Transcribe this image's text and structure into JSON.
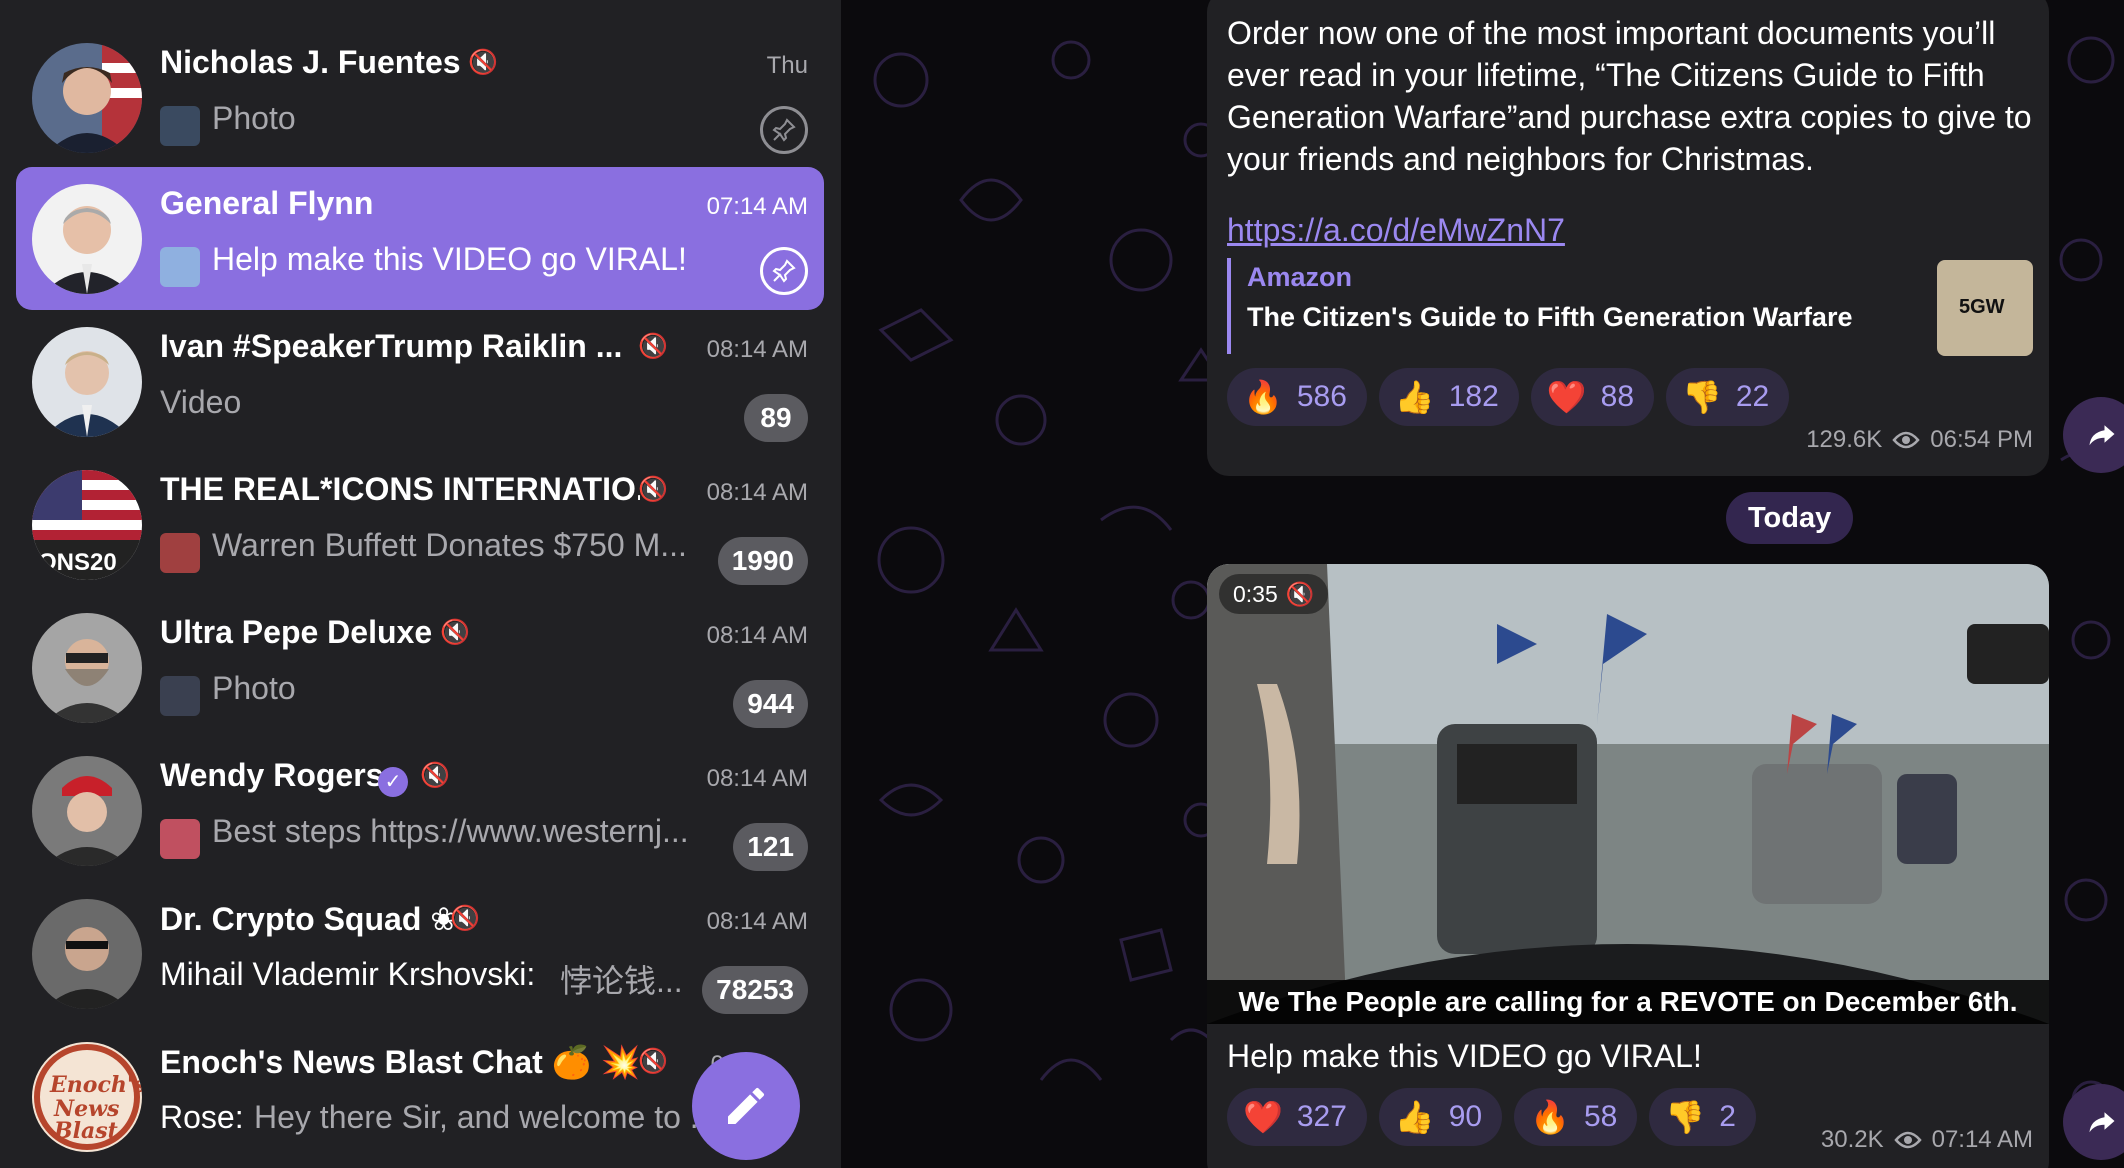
{
  "chat_list": [
    {
      "name": "Nicholas J. Fuentes",
      "muted": true,
      "time": "Thu",
      "preview_prefix": "",
      "preview": "Photo",
      "pinned": true,
      "active": false,
      "badge": ""
    },
    {
      "name": "General Flynn",
      "muted": false,
      "time": "07:14 AM",
      "preview_prefix": "",
      "preview": "Help make this VIDEO go VIRAL!",
      "pinned": true,
      "active": true,
      "badge": ""
    },
    {
      "name": "Ivan #SpeakerTrump Raiklin ...",
      "muted": true,
      "time": "08:14 AM",
      "preview_prefix": "",
      "preview": "Video",
      "pinned": false,
      "active": false,
      "badge": "89"
    },
    {
      "name": "THE REAL*ICONS INTERNATIO...",
      "muted": true,
      "time": "08:14 AM",
      "preview_prefix": "",
      "preview": "Warren Buffett Donates $750 M...",
      "pinned": false,
      "active": false,
      "badge": "1990"
    },
    {
      "name": "Ultra Pepe Deluxe",
      "muted": true,
      "time": "08:14 AM",
      "preview_prefix": "",
      "preview": "Photo",
      "pinned": false,
      "active": false,
      "badge": "944"
    },
    {
      "name": "Wendy Rogers",
      "muted": true,
      "verified": true,
      "time": "08:14 AM",
      "preview_prefix": "",
      "preview": "Best steps https://www.westernj...",
      "pinned": false,
      "active": false,
      "badge": "121"
    },
    {
      "name": "Dr. Crypto Squad ❀",
      "muted": true,
      "time": "08:14 AM",
      "preview_prefix": "Mihail Vlademir Krshovski:",
      "preview": "悖论钱...",
      "pinned": false,
      "active": false,
      "badge": "78253"
    },
    {
      "name": "Enoch's News Blast Chat 🍊 💥...",
      "muted": true,
      "time": "0",
      "preview_prefix": "Rose:",
      "preview": "Hey there Sir, and welcome to ...",
      "pinned": false,
      "active": false,
      "badge": ""
    }
  ],
  "messages": {
    "first": {
      "text": "Order now one of the most important documents you’ll ever read in your lifetime, “The Citizens Guide to Fifth Generation Warfare”and purchase extra copies to give to your friends and neighbors for Christmas.",
      "link": "https://a.co/d/eMwZnN7",
      "preview_site": "Amazon",
      "preview_title": "The Citizen's Guide to Fifth Generation Warfare",
      "preview_thumb_text": "5GW",
      "reactions": [
        {
          "emoji": "🔥",
          "count": "586"
        },
        {
          "emoji": "👍",
          "count": "182"
        },
        {
          "emoji": "❤️",
          "count": "88"
        },
        {
          "emoji": "👎",
          "count": "22"
        }
      ],
      "views": "129.6K",
      "time": "06:54 PM"
    },
    "date_separator": "Today",
    "second": {
      "video_duration": "0:35",
      "video_subtitle": "We The People are calling for a REVOTE on December 6th.",
      "caption": "Help make this VIDEO go VIRAL!",
      "reactions": [
        {
          "emoji": "❤️",
          "count": "327"
        },
        {
          "emoji": "👍",
          "count": "90"
        },
        {
          "emoji": "🔥",
          "count": "58"
        },
        {
          "emoji": "👎",
          "count": "2"
        }
      ],
      "views": "30.2K",
      "time": "07:14 AM"
    }
  },
  "colors": {
    "accent": "#8a6fe0",
    "sidebar_bg": "#212124",
    "chat_bg": "#0b0a0d",
    "bubble_bg": "#212124",
    "link": "#9b88f0",
    "badge_bg": "#5b5b60"
  },
  "icons": [
    "mute-icon",
    "pin-icon",
    "verified-icon",
    "pencil-icon",
    "eye-icon",
    "share-icon"
  ]
}
